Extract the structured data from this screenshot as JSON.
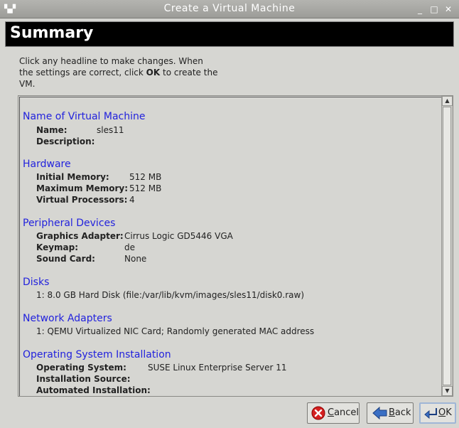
{
  "window": {
    "title": "Create a Virtual Machine",
    "menu_icon": "window-menu-icon",
    "controls": [
      "_",
      "□",
      "✕"
    ]
  },
  "header": {
    "title": "Summary"
  },
  "intro": {
    "line1": "Click any headline to make changes.  When",
    "line2_pre": "the settings are correct, click ",
    "line2_bold": "OK",
    "line2_post": " to create the",
    "line3": "VM."
  },
  "sections": {
    "name": {
      "title": "Name of Virtual Machine",
      "name_label": "Name:",
      "name_value": "sles11",
      "desc_label": "Description:",
      "desc_value": ""
    },
    "hardware": {
      "title": "Hardware",
      "initial_label": "Initial Memory:",
      "initial_value": "512 MB",
      "max_label": "Maximum Memory:",
      "max_value": "512 MB",
      "cpu_label": "Virtual Processors:",
      "cpu_value": "4"
    },
    "peripheral": {
      "title": "Peripheral Devices",
      "graphics_label": "Graphics Adapter:",
      "graphics_value": "Cirrus Logic GD5446 VGA",
      "keymap_label": "Keymap:",
      "keymap_value": "de",
      "sound_label": "Sound Card:",
      "sound_value": "None"
    },
    "disks": {
      "title": "Disks",
      "item1": "1: 8.0 GB Hard Disk (file:/var/lib/kvm/images/sles11/disk0.raw)"
    },
    "network": {
      "title": "Network Adapters",
      "item1": "1: QEMU Virtualized NIC Card; Randomly generated MAC address"
    },
    "os": {
      "title": "Operating System Installation",
      "os_label": "Operating System:",
      "os_value": "SUSE Linux Enterprise Server 11",
      "source_label": "Installation Source:",
      "source_value": "",
      "auto_label": "Automated Installation:",
      "auto_value": ""
    }
  },
  "buttons": {
    "cancel": {
      "mnemonic": "C",
      "rest": "ancel",
      "icon": "cancel-icon"
    },
    "back": {
      "mnemonic": "B",
      "rest": "ack",
      "icon": "back-arrow-icon"
    },
    "ok": {
      "mnemonic": "O",
      "rest": "K",
      "icon": "ok-icon"
    }
  },
  "colors": {
    "section_link": "#2222dd",
    "header_bg": "#000000"
  }
}
